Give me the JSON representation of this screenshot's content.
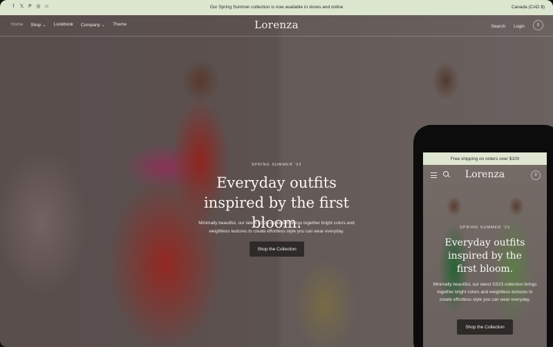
{
  "announcement": {
    "social_icons": [
      "facebook-icon",
      "x-icon",
      "pinterest-icon",
      "instagram-icon",
      "snapchat-icon"
    ],
    "social_glyphs": [
      "f",
      "𝕏",
      "P",
      "◎",
      "☺"
    ],
    "message": "Our Spring Summer collection is now available in stores and online",
    "currency": "Canada (CAD $)"
  },
  "nav": {
    "items": [
      {
        "label": "Home"
      },
      {
        "label": "Shop ⌄"
      },
      {
        "label": "Lookbook"
      },
      {
        "label": "Company ⌄"
      },
      {
        "label": "Theme"
      }
    ],
    "logo": "Lorenza",
    "search": "Search",
    "login": "Login",
    "cart_count": "0"
  },
  "hero": {
    "eyebrow": "SPRING SUMMER '23",
    "headline": "Everyday outfits inspired by the first bloom.",
    "subtext": "Minimally beautiful, our latest SS23 collection brings together bright colors and weightless textures to create effortless style you can wear everyday.",
    "cta": "Shop the Collection"
  },
  "mobile": {
    "announcement": "Free shipping on orders over $100",
    "logo": "Lorenza",
    "cart_count": "0",
    "eyebrow": "SPRING SUMMER '23",
    "headline": "Everyday outfits inspired by the first bloom.",
    "subtext": "Minimally beautiful, our latest SS23 collection brings together bright colors and weightless textures to create effortless style you can wear everyday.",
    "cta": "Shop the Collection"
  },
  "colors": {
    "announcement_bg": "#dde6cf",
    "button_bg": "#2e2a28"
  }
}
